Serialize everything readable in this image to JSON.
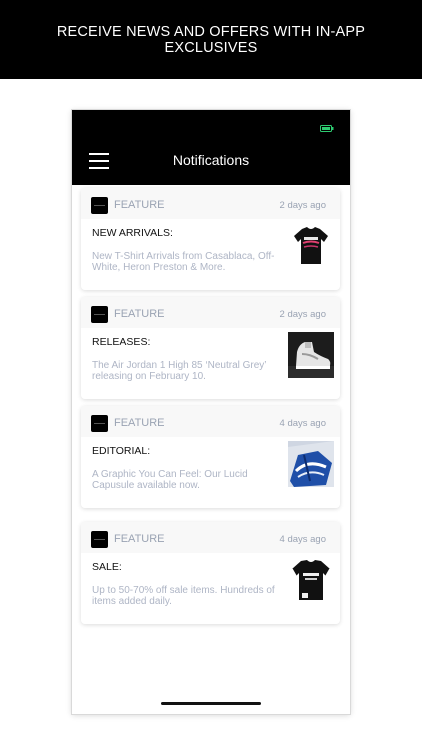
{
  "promo": {
    "text": "RECEIVE NEWS AND OFFERS WITH IN-APP EXCLUSIVES"
  },
  "status_bar": {
    "battery_color": "#2ecc71"
  },
  "header": {
    "title": "Notifications"
  },
  "notifications": [
    {
      "category": "FEATURE",
      "time": "2 days ago",
      "title": "NEW ARRIVALS:",
      "description": "New T-Shirt Arrivals from Casablaca, Off-White, Heron Preston & More.",
      "thumbnail": "black-tshirt"
    },
    {
      "category": "FEATURE",
      "time": "2 days ago",
      "title": "RELEASES:",
      "description": "The Air Jordan 1 High 85 ‘Neutral Grey’ releasing on February 10.",
      "thumbnail": "sneaker"
    },
    {
      "category": "FEATURE",
      "time": "4 days ago",
      "title": "EDITORIAL:",
      "description": "A Graphic You Can Feel: Our Lucid Capusule available now.",
      "thumbnail": "graphic-print"
    },
    {
      "category": "FEATURE",
      "time": "4 days ago",
      "title": "SALE:",
      "description": "Up to 50-70% off sale items. Hundreds of items added daily.",
      "thumbnail": "jersey"
    }
  ],
  "colors": {
    "meta_text": "#9aa3b3",
    "description_text": "#aeb5c5",
    "header_bg": "#000000"
  }
}
